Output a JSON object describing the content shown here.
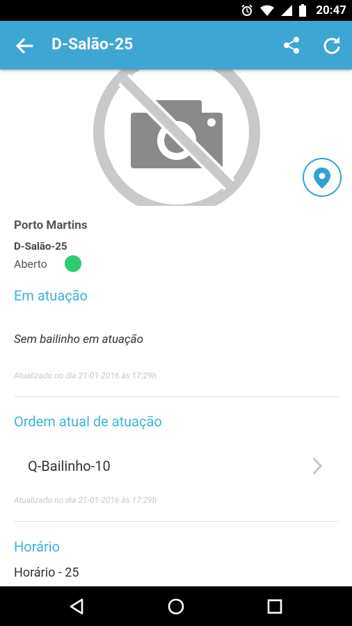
{
  "status_bar": {
    "time": "20:47"
  },
  "app_bar": {
    "title": "D-Salão-25"
  },
  "venue": {
    "place": "Porto Martins",
    "code": "D-Salão-25",
    "status": "Aberto",
    "status_color": "#2ecc71"
  },
  "current": {
    "heading": "Em atuação",
    "text": "Sem bailinho em atuação",
    "updated": "Atualizado no dia 21-01-2016 às 17:29h"
  },
  "order": {
    "heading": "Ordem atual de atuação",
    "item": "Q-Bailinho-10",
    "updated": "Atualizado no dia 21-01-2016 às 17:29h"
  },
  "schedule": {
    "heading": "Horário",
    "value": "Horário - 25"
  },
  "colors": {
    "accent": "#3ea6d3",
    "section": "#3ab4dc"
  }
}
